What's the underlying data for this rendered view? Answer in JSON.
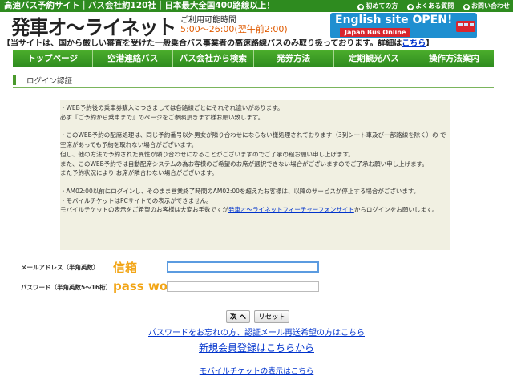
{
  "topbar": {
    "tagline": "高速バス予約サイト｜バス会社約120社｜日本最大全国400路線以上！",
    "links": [
      "初めての方",
      "よくある質問",
      "お問い合わせ"
    ]
  },
  "header": {
    "logo": "発車オ〜ライネット",
    "hours_label": "ご利用可能時間",
    "hours_value": "5:00〜26:00(翌午前2:00)",
    "english_banner": "English site OPEN!",
    "english_sub": "Japan Bus Online"
  },
  "notice": {
    "text": "【当サイトは、国から厳しい審査を受けた一般乗合バス事業者の高速路線バスのみ取り扱っております。詳細は",
    "link": "こちら",
    "close": "】"
  },
  "nav": {
    "items": [
      "トップページ",
      "空港連絡バス",
      "バス会社から検索",
      "発券方法",
      "定期観光バス",
      "操作方法案内"
    ]
  },
  "section": {
    "title": "ログイン認証"
  },
  "info": {
    "p1": "・WEB予約後の乗車券購入につきましては各路線ごとにそれぞれ違いがあります。\n必ず『ご予約から乗車まで』のページをご参照頂きます様お願い致します。",
    "p2": "・このWEB予約の配席処理は、同じ予約番号以外男女が隣り合わせにならない様処理されております（3列シート車及び一部路線を除く）の で空席があっても予約を取れない場合がございます。\n但し、他の方法で予約された異性が隣り合わせになることがございますのでご了承の程お願い申し上げます。\nまた、このWEB予約では自動配席システムの為お客様のご希望のお席が選択できない場合がございますのでご了承お願い申し上げます。\nまた予約状況により お席が隣合わない場合がございます。",
    "p3": "・AM02:00以前にログインし、そのまま営業終了時間のAM02:00を超えたお客様は、以降のサービスが停止する場合がございます。\n・モバイルチケットはPCサイトでの表示ができません。",
    "p4_pre": "モバイルチケットの表示をご希望のお客様は大変お手数ですが",
    "p4_link": "発車オ〜ライネットフィーチャーフォンサイト",
    "p4_post": "からログインをお願いします。"
  },
  "form": {
    "email_label": "メールアドレス（半角英数）",
    "email_annotation": "信箱",
    "email_value": "",
    "password_label": "パスワード（半角英数5〜16桁）",
    "password_annotation": "pass word",
    "password_value": ""
  },
  "buttons": {
    "next": "次 へ",
    "reset": "リセット"
  },
  "links": {
    "forgot": "パスワードをお忘れの方、認証メール再送希望の方はこちら",
    "signup": "新規会員登録はこちらから",
    "mobile": "モバイルチケットの表示はこちら"
  }
}
